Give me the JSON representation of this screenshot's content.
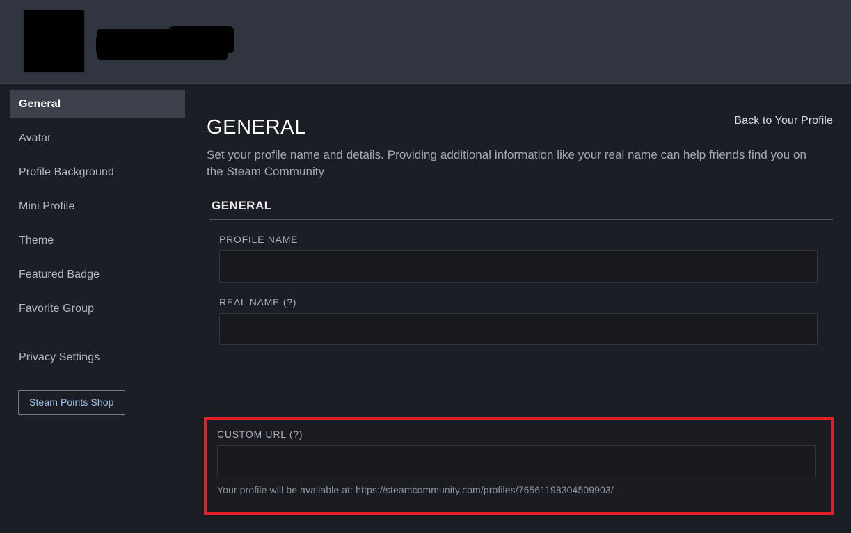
{
  "profile_header": {
    "avatar": "redacted-avatar",
    "persona_name": "redacted-persona-name"
  },
  "sidebar": {
    "items": [
      {
        "label": "General",
        "selected": true
      },
      {
        "label": "Avatar",
        "selected": false
      },
      {
        "label": "Profile Background",
        "selected": false
      },
      {
        "label": "Mini Profile",
        "selected": false
      },
      {
        "label": "Theme",
        "selected": false
      },
      {
        "label": "Featured Badge",
        "selected": false
      },
      {
        "label": "Favorite Group",
        "selected": false
      },
      {
        "label": "Privacy Settings",
        "selected": false
      }
    ],
    "points_shop_button": "Steam Points Shop"
  },
  "main": {
    "back_link": "Back to Your Profile",
    "title": "GENERAL",
    "description": "Set your profile name and details. Providing additional information like your real name can help friends find you on the Steam Community",
    "section_header": "GENERAL",
    "fields": {
      "profile_name": {
        "label": "PROFILE NAME",
        "value": "",
        "placeholder": ""
      },
      "real_name": {
        "label": "REAL NAME (?)",
        "value": "",
        "placeholder": ""
      },
      "custom_url": {
        "label": "CUSTOM URL (?)",
        "value": "",
        "placeholder": ""
      }
    },
    "url_hint": "Your profile will be available at: https://steamcommunity.com/profiles/76561198304509903/"
  },
  "colors": {
    "header_band": "#31353f",
    "page_background": "#1c1e25",
    "input_background": "#17191e",
    "selected_nav": "#3d414c",
    "highlight_red": "#e01f28",
    "link_blue": "#9fc3e8"
  }
}
